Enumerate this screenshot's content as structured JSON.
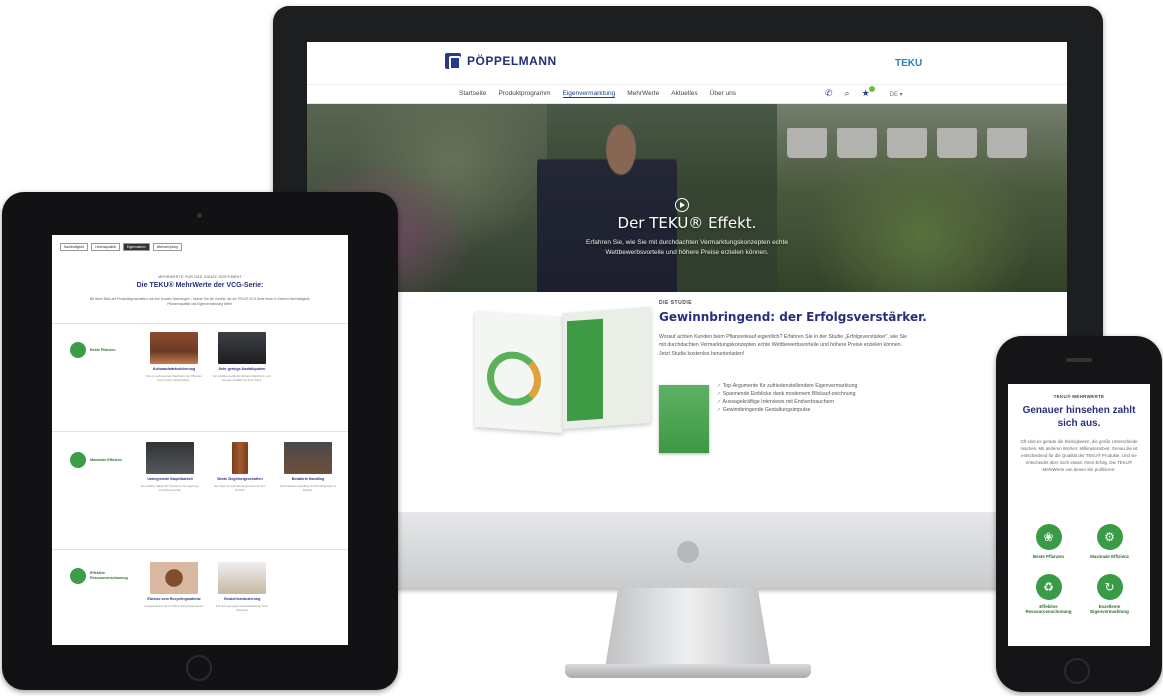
{
  "desktop": {
    "brand": "PÖPPELMANN",
    "teku_logo": "TEKU",
    "nav": [
      "Startseite",
      "Produktprogramm",
      "Eigenvermarktung",
      "MehrWerte",
      "Aktuelles",
      "Über uns"
    ],
    "nav_active_index": 2,
    "lang": "DE ▾",
    "hero_title": "Der TEKU® Effekt.",
    "hero_sub": "Erfahren Sie, wie Sie mit durchdachten Vermarktungskonzepten echte Wettbewerbsvorteile und höhere Preise erzielen können.",
    "study_label": "DIE STUDIE",
    "study_title": "Gewinnbringend: der Erfolgsverstärker.",
    "study_text": "Worauf achten Kunden beim Pflanzenkauf eigentlich? Erfahren Sie in der Studie „Erfolgsverstärker\", wie Sie mit durchdachten Vermarktungskonzepten echte Wettbewerbsvorteile und höhere Preise erzielen können. Jetzt Studie kostenlos herunterladen!",
    "checklist": [
      "Top-Argumente für zufriedenstellendere Eigenvermarktung",
      "Spannende Einblicke dank modernem Blickauf-zeichnung",
      "Aussagekräftige Interviews mit Endverbrauchern",
      "Gewinnbringende Gestaltungsimpulse"
    ]
  },
  "tablet": {
    "tabs": [
      "Nachhaltigkeit",
      "Lebensqualität",
      "Eigenmarken",
      "Wertschöpfung"
    ],
    "active_tab_index": 2,
    "kicker": "MEHRWERTE FÜR DAS GANZE SORTIMENT",
    "title": "Die TEKU® MehrWerte der VCG-Serie:",
    "intro": "Mit Ihrem Blick auf Produkteigenschaften, die Ihre Kunden überzeugen – Nutzen Sie die Vorteile, die die TEKU® VCG-Serie Ihnen in Sachen Nachhaltigkeit, Pflanzenqualität und Eigenvermarktung bietet.",
    "sections": [
      {
        "category": "Beste Pflanzen",
        "features": [
          {
            "title": "Kulturaufwärtssicherung",
            "text": "Für ein verbessertes Wachstum der Pflanzen durch mehr Luftzirkulation."
          },
          {
            "title": "Sehr geringe Ausfallquoten",
            "text": "Ein stabiles Gefäß für sicheres Wachstum und weniger Ausfälle bei Ihrer Kultur."
          }
        ]
      },
      {
        "category": "Maximale Effizienz",
        "features": [
          {
            "title": "Unbegrenzte Stapelbarkeit",
            "text": "Ein stabiler Stapel für Transport und Lagerung mit sicherem Halt."
          },
          {
            "title": "Beste Ziegelbeigeschaften",
            "text": "Ein Topf mit optimaler Ergonomie für den Vertrieb."
          },
          {
            "title": "Bewährte Handling",
            "text": "Durchdachtes Handling für Ihre Mitarbeiter im Betrieb."
          }
        ]
      },
      {
        "category": "Effektive Ressourcenschonung",
        "features": [
          {
            "title": "Ebenso vom Recyclingmaterial",
            "text": "Hergestellt aus bis zu 100 % Recyclingmaterial."
          },
          {
            "title": "Gewichtsreduzierung",
            "text": "Für eine geringere Umweltbelastung beim Transport."
          }
        ]
      }
    ]
  },
  "phone": {
    "kicker": "TEKU® MEHRWERTE",
    "title": "Genauer hinsehen zahlt sich aus.",
    "text": "Oft sind es gerade die Kleinigkeiten, die große Unterschiede machen. Mit anderen Worten: Millimeterarbeit. Genau die ist entscheidend für die Qualität der TEKU® Produkte. Und sie entscheidet über noch etwas: Ihren Erfolg. Die TEKU® MehrWerte von denen Sie profitieren:",
    "items": [
      {
        "label": "Beste Pflanzen",
        "icon": "plant-icon"
      },
      {
        "label": "Maximale Effizienz",
        "icon": "efficiency-icon"
      },
      {
        "label": "Effektive Ressourcenschonung",
        "icon": "recycle-icon"
      },
      {
        "label": "Exzellente Eigenvermarktung",
        "icon": "marketing-icon"
      }
    ]
  },
  "colors": {
    "brand_blue": "#2a2f7c",
    "green": "#3d9c48"
  }
}
